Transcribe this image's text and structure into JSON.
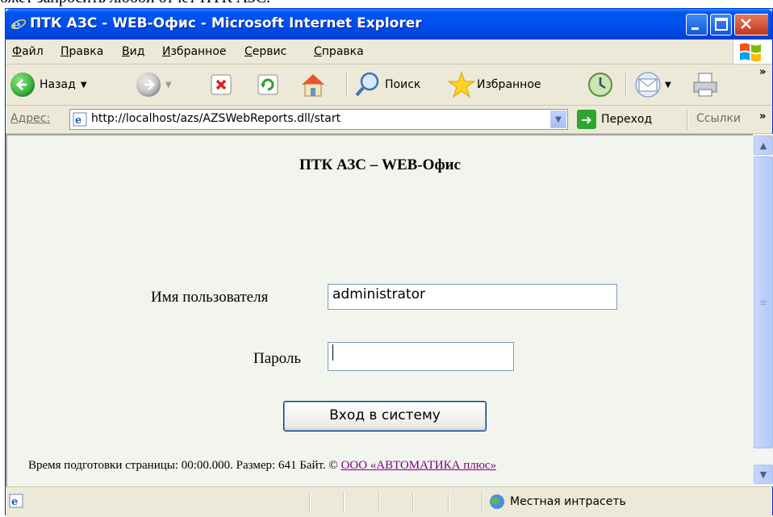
{
  "document_text": "ожет запросить любой отчет ПТК АЗС.",
  "window": {
    "title": "ПТК АЗС - WEB-Офис - Microsoft Internet Explorer"
  },
  "menu": [
    "Файл",
    "Правка",
    "Вид",
    "Избранное",
    "Сервис",
    "Справка"
  ],
  "toolbar": {
    "back": "Назад",
    "search": "Поиск",
    "favorites": "Избранное",
    "more": "»"
  },
  "address": {
    "label_prefix": "Адрес",
    "label_hotkey": ":",
    "url": "http://localhost/azs/AZSWebReports.dll/start",
    "go": "Переход",
    "links": "Ссылки",
    "more": "»"
  },
  "page": {
    "title": "ПТК АЗС – WEB-Офис",
    "username_label": "Имя пользователя",
    "username_value": "administrator",
    "password_label": "Пароль",
    "login_button": "Вход в систему",
    "footer_text": "Время подготовки страницы: 00:00.000. Размер: 641 Байт. © ",
    "footer_link": "ООО «АВТОМАТИКА плюс»"
  },
  "status": {
    "zone": "Местная интрасеть"
  },
  "colors": {
    "titlebar": "#0054E3",
    "content_bg": "#F2F5EE",
    "link_visited": "#800080"
  }
}
